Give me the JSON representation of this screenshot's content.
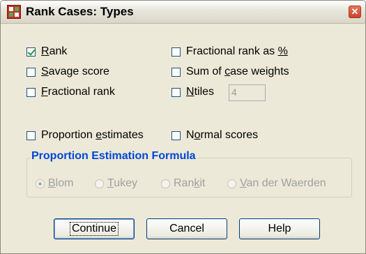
{
  "window": {
    "title": "Rank Cases: Types",
    "close_glyph": "✕",
    "app_icon": "spss-grid-icon"
  },
  "options": {
    "rank": {
      "pre": "",
      "key": "R",
      "post": "ank",
      "checked": true
    },
    "fractional_rank_pct": {
      "pre": "Fractional rank as ",
      "key": "%",
      "post": "",
      "checked": false
    },
    "savage_score": {
      "pre": "",
      "key": "S",
      "post": "avage score",
      "checked": false
    },
    "sum_case_weights": {
      "pre": "Sum of ",
      "key": "c",
      "post": "ase weights",
      "checked": false
    },
    "fractional_rank": {
      "pre": "",
      "key": "F",
      "post": "ractional rank",
      "checked": false
    },
    "ntiles": {
      "pre": "",
      "key": "N",
      "post": "tiles",
      "checked": false,
      "value": "4"
    },
    "proportion_estimates": {
      "pre": "Proportion ",
      "key": "e",
      "post": "stimates",
      "checked": false
    },
    "normal_scores": {
      "pre": "N",
      "key": "o",
      "post": "rmal scores",
      "checked": false
    }
  },
  "formula_group": {
    "title": "Proportion Estimation Formula",
    "radios": [
      {
        "pre": "",
        "key": "B",
        "post": "lom",
        "selected": true
      },
      {
        "pre": "",
        "key": "T",
        "post": "ukey",
        "selected": false
      },
      {
        "pre": "Ran",
        "key": "k",
        "post": "it",
        "selected": false
      },
      {
        "pre": "",
        "key": "V",
        "post": "an der Waerden",
        "selected": false
      }
    ]
  },
  "buttons": {
    "continue": "Continue",
    "cancel": "Cancel",
    "help": "Help"
  }
}
